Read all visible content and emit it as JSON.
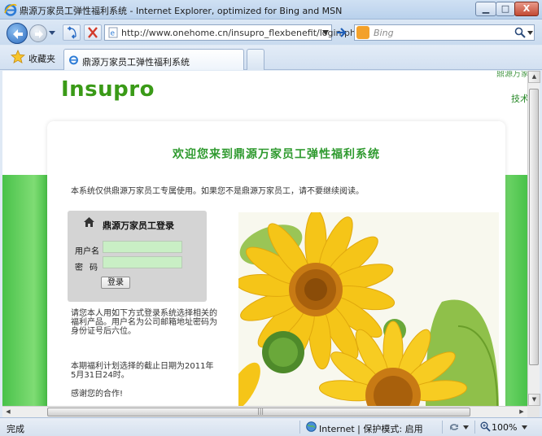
{
  "window": {
    "title": "鼎源万家员工弹性福利系统 - Internet Explorer, optimized for Bing and MSN",
    "min_label": "▁",
    "max_label": "□",
    "close_label": "X"
  },
  "address_bar": {
    "url": "http://www.onehome.cn/insupro_flexbenefit/login.php",
    "search_placeholder": "Bing"
  },
  "tabs": {
    "favorites_label": "收藏夹",
    "active_tab_label": "鼎源万家员工弹性福利系统"
  },
  "page": {
    "logo": "Insupro",
    "corner_text": "鼎源万家",
    "corner_link": "技术",
    "headline": "欢迎您来到鼎源万家员工弹性福利系统",
    "notice": "本系统仅供鼎源万家员工专属使用。如果您不是鼎源万家员工，请不要继续阅读。",
    "login": {
      "title": "鼎源万家员工登录",
      "username_label": "用户名",
      "password_label": "密码",
      "submit_label": "登录"
    },
    "info1": "请您本人用如下方式登录系统选择相关的福利产品。用户名为公司邮箱地址密码为身份证号后六位。",
    "info2": "本期福利计划选择的截止日期为2011年5月31日24时。",
    "info3": "感谢您的合作!"
  },
  "statusbar": {
    "status": "完成",
    "zone": "Internet | 保护模式: 启用",
    "zoom": "100%"
  },
  "colors": {
    "brand_green": "#3a9a17",
    "headline_green": "#2f9a2f",
    "band_green": "#3fbb3f",
    "input_green": "#c9efc5"
  }
}
